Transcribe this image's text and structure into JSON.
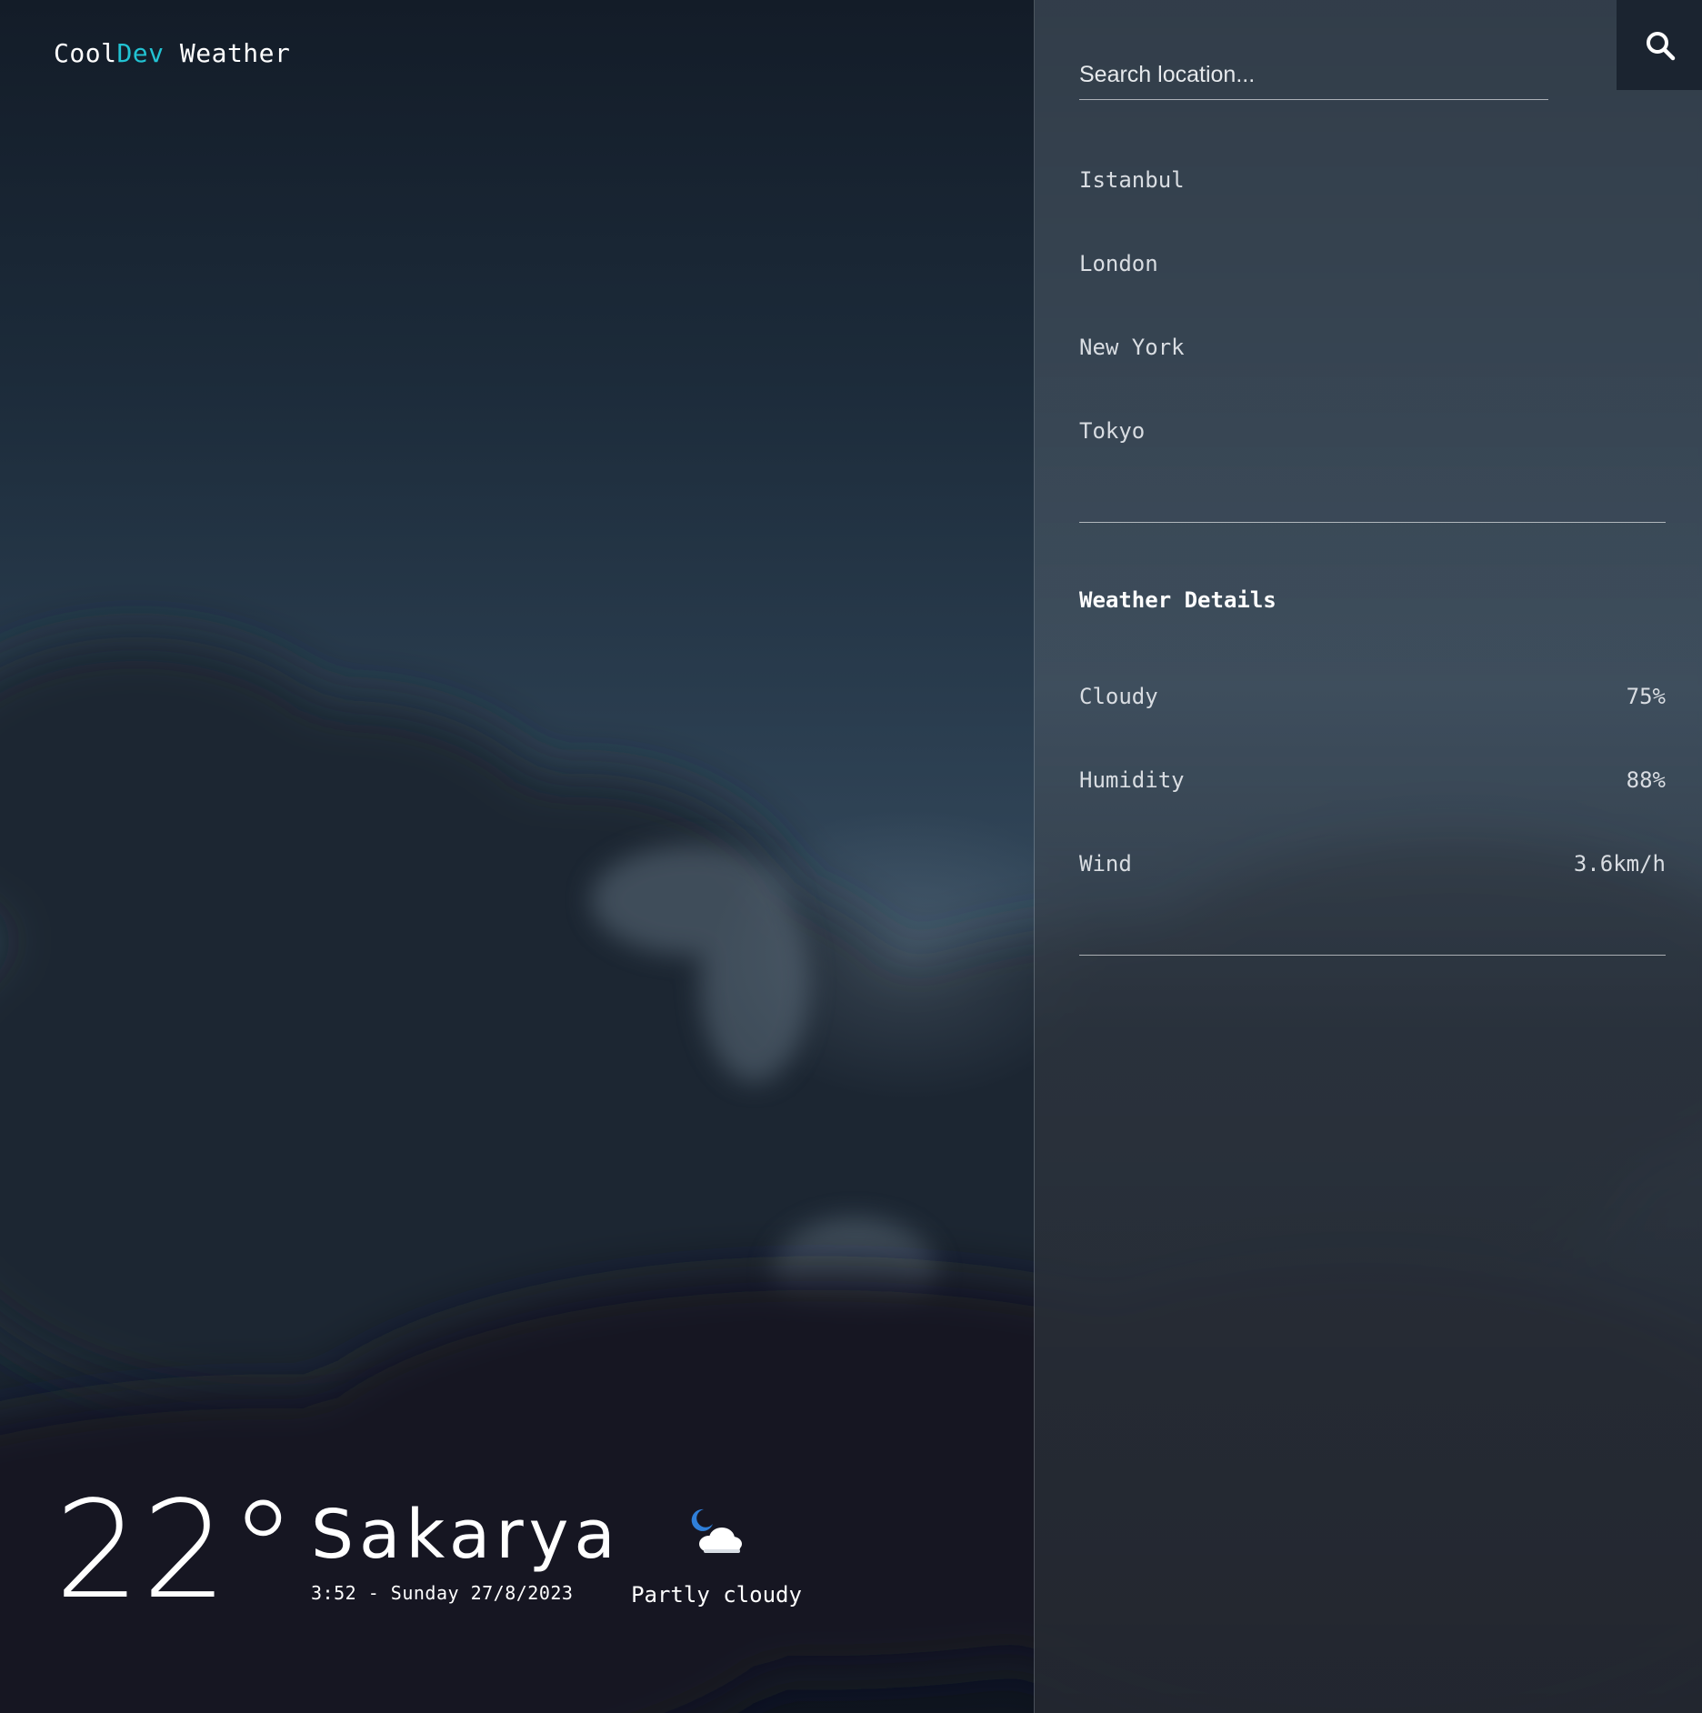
{
  "brand": {
    "part1": "Cool",
    "part2": "Dev",
    "part3": " Weather",
    "accent_color": "#22c3d3"
  },
  "current": {
    "temperature": "22°",
    "city": "Sakarya",
    "datetime": "3:52 - Sunday 27/8/2023",
    "condition": "Partly cloudy",
    "condition_icon": "partly-cloudy-night-icon"
  },
  "search": {
    "placeholder": "Search location...",
    "value": "",
    "button_icon": "search-icon"
  },
  "locations": [
    "Istanbul",
    "London",
    "New York",
    "Tokyo"
  ],
  "details": {
    "title": "Weather Details",
    "rows": [
      {
        "label": "Cloudy",
        "value": "75%"
      },
      {
        "label": "Humidity",
        "value": "88%"
      },
      {
        "label": "Wind",
        "value": "3.6km/h"
      }
    ]
  }
}
